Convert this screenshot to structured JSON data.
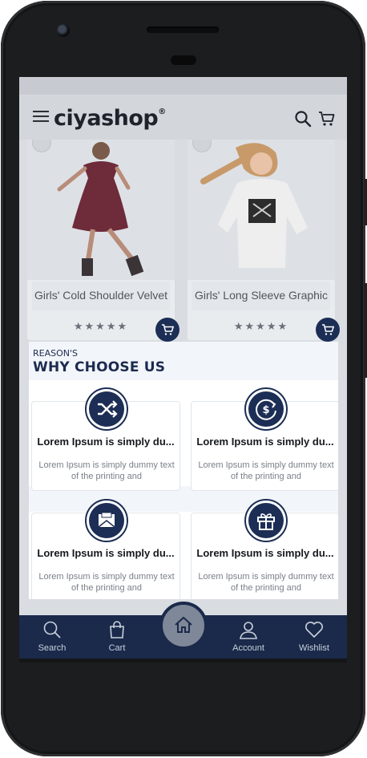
{
  "app": {
    "logo": "ciyashop",
    "logo_mark": "®"
  },
  "products": [
    {
      "title": "Girls' Cold Shoulder Velvet",
      "rating": "★★★★★"
    },
    {
      "title": "Girls' Long Sleeve Graphic",
      "rating": "★★★★★"
    }
  ],
  "modal": {
    "kicker": "REASON'S",
    "heading": "WHY CHOOSE US",
    "features": [
      {
        "icon": "shuffle-icon",
        "title": "Lorem Ipsum is simply du...",
        "text": "Lorem Ipsum is simply dummy text of the printing and"
      },
      {
        "icon": "dollar-refresh-icon",
        "title": "Lorem Ipsum is simply du...",
        "text": "Lorem Ipsum is simply dummy text of the printing and"
      },
      {
        "icon": "envelope-icon",
        "title": "Lorem Ipsum is simply du...",
        "text": "Lorem Ipsum is simply dummy text of the printing and"
      },
      {
        "icon": "gift-icon",
        "title": "Lorem Ipsum is simply du...",
        "text": "Lorem Ipsum is simply dummy text of the printing and"
      }
    ]
  },
  "bottom_nav": {
    "search": "Search",
    "cart": "Cart",
    "home": "home-icon",
    "account": "Account",
    "wishlist": "Wishlist"
  },
  "colors": {
    "brand_navy": "#1c2e55",
    "nav_bg": "#1b2a4b",
    "overlay": "#d9dde2"
  }
}
